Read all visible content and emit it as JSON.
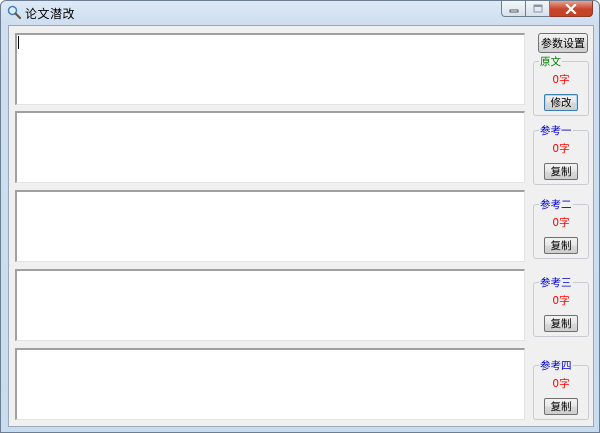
{
  "window": {
    "title": "论文潜改",
    "icon": "magnifier-icon",
    "minimize_icon": "minimize-icon",
    "maximize_icon": "maximize-icon",
    "close_icon": "close-icon"
  },
  "toolbar": {
    "settings_label": "参数设置"
  },
  "colors": {
    "original_label": "#008000",
    "reference_label": "#0000cc",
    "count": "#ff0000"
  },
  "panels": [
    {
      "label": "原文",
      "count": "0字",
      "button": "修改",
      "text": ""
    },
    {
      "label": "参考一",
      "count": "0字",
      "button": "复制",
      "text": ""
    },
    {
      "label": "参考二",
      "count": "0字",
      "button": "复制",
      "text": ""
    },
    {
      "label": "参考三",
      "count": "0字",
      "button": "复制",
      "text": ""
    },
    {
      "label": "参考四",
      "count": "0字",
      "button": "复制",
      "text": ""
    }
  ]
}
